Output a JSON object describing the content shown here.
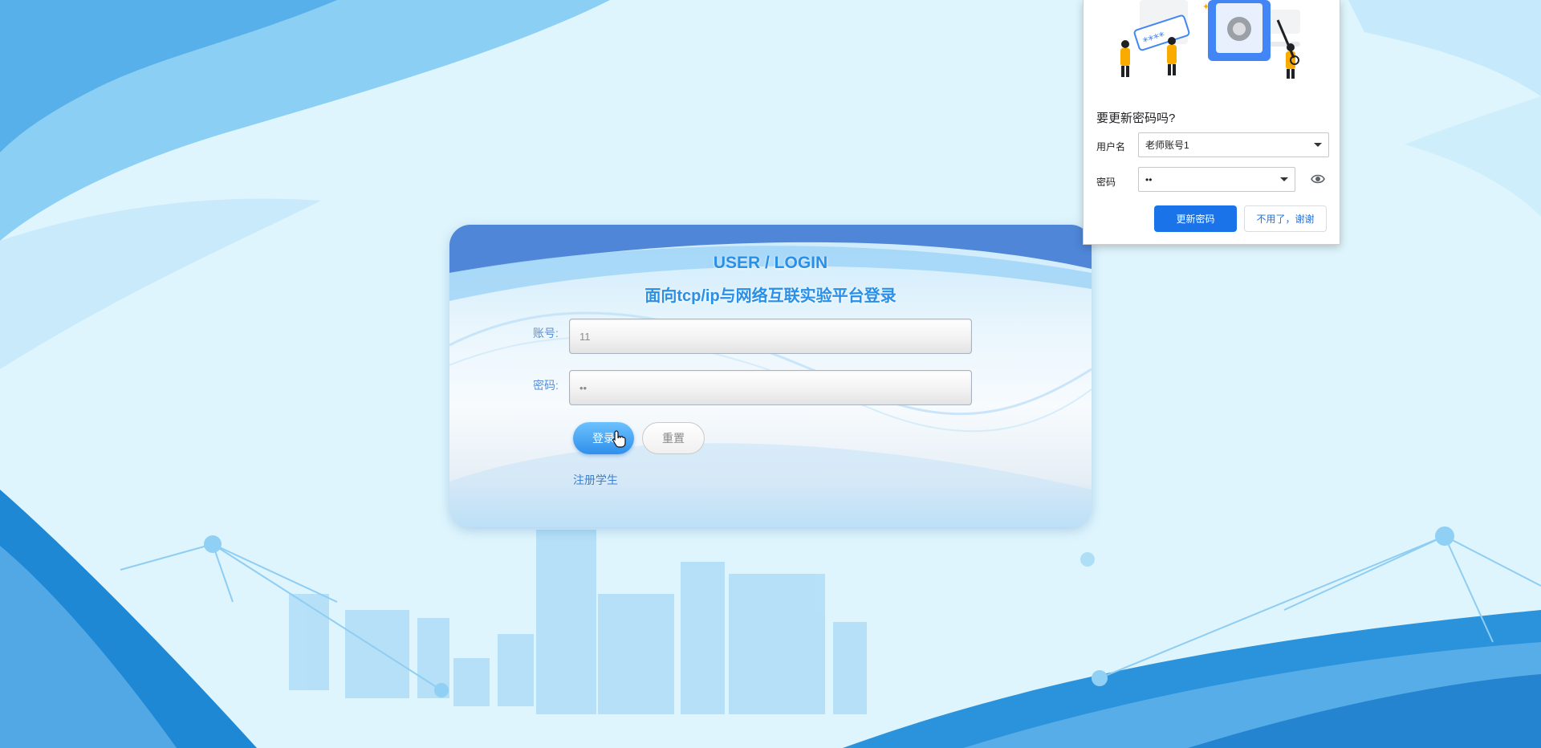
{
  "login": {
    "title_en": "USER / LOGIN",
    "title_cn": "面向tcp/ip与网络互联实验平台登录",
    "account_label": "账号:",
    "account_value": "11",
    "password_label": "密码:",
    "password_value": "••",
    "login_button": "登录",
    "reset_button": "重置",
    "register_link": "注册学生"
  },
  "password_popup": {
    "heading": "要更新密码吗?",
    "username_label": "用户名",
    "username_value": "老师账号1",
    "password_label": "密码",
    "password_value": "••",
    "update_button": "更新密码",
    "decline_button": "不用了，谢谢",
    "illustration_text": "****"
  },
  "colors": {
    "accent": "#1a73e8",
    "title_blue": "#2a8fe6",
    "page_bg": "#dff5fd"
  },
  "icons": [
    "eye-icon",
    "chevron-down-icon",
    "hand-cursor-icon",
    "safe-icon",
    "key-icon"
  ]
}
